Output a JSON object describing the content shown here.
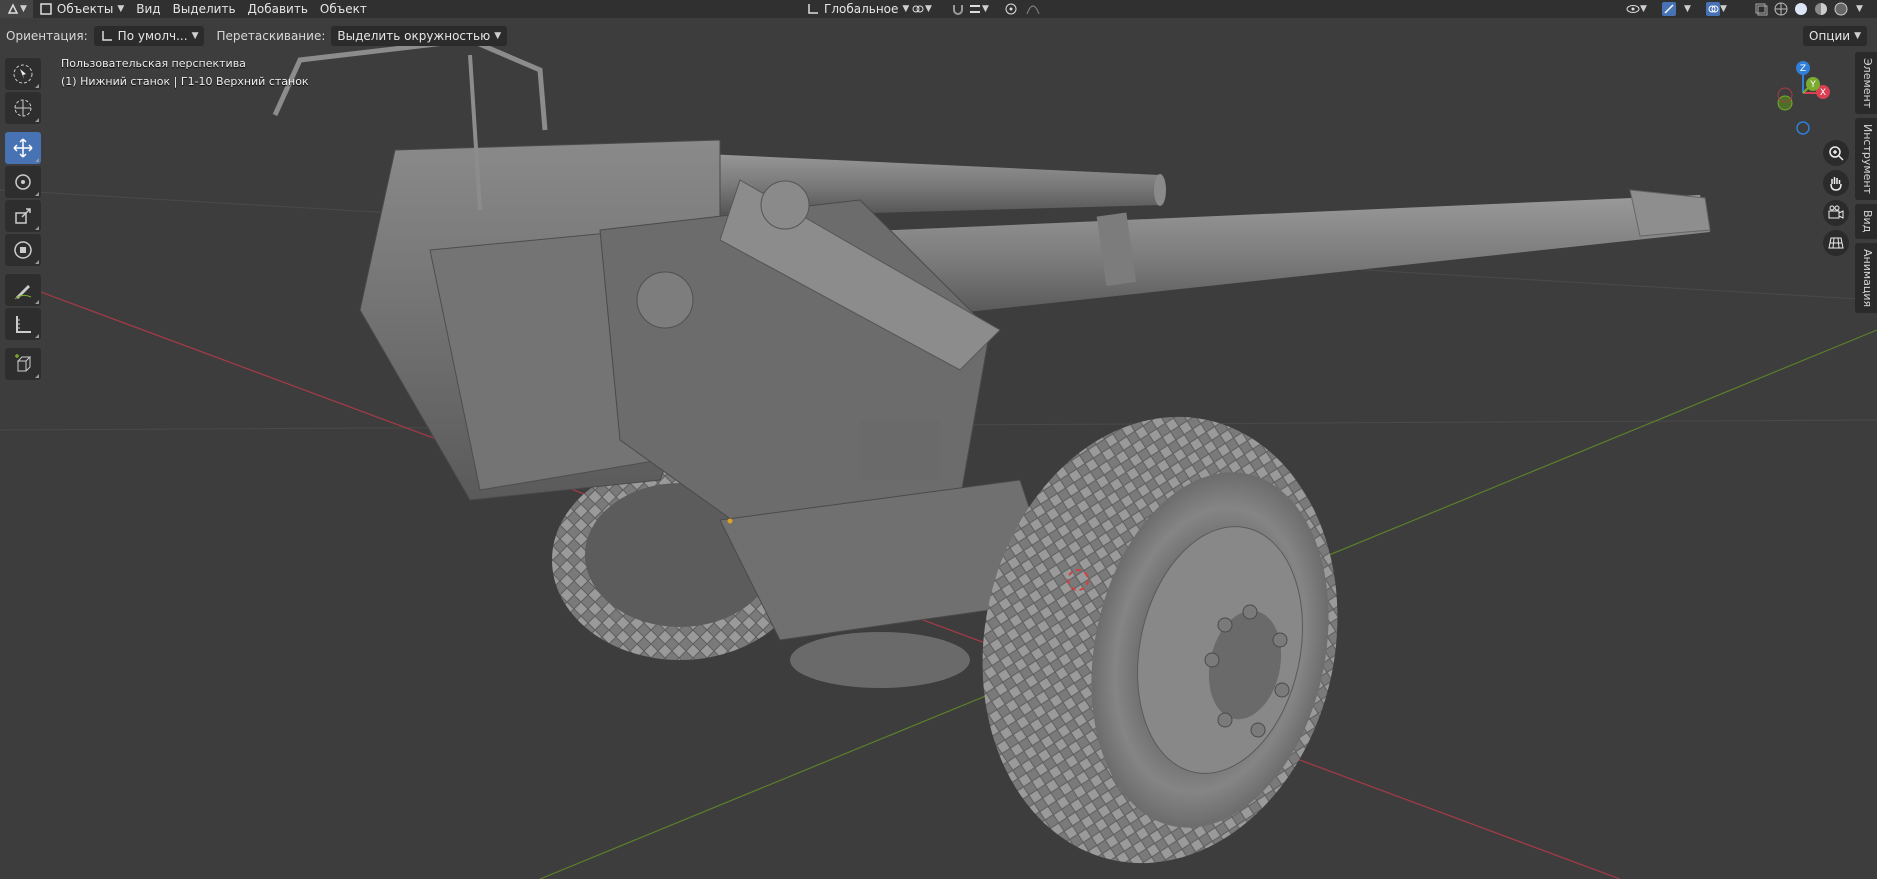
{
  "header": {
    "mode_label": "Объекты",
    "menus": [
      "Вид",
      "Выделить",
      "Добавить",
      "Объект"
    ],
    "transform_orientation": "Глобальное"
  },
  "tool_header": {
    "orientation_label": "Ориентация:",
    "orientation_value": "По умолч...",
    "drag_label": "Перетаскивание:",
    "drag_value": "Выделить окружностью",
    "options_label": "Опции"
  },
  "viewport": {
    "view_name": "Пользовательская перспектива",
    "object_info": "(1) Нижний станок | Г1-10 Верхний станок"
  },
  "gizmo": {
    "z": "Z",
    "y": "Y",
    "x": "X"
  },
  "side_tabs": [
    "Элемент",
    "Инструмент",
    "Вид",
    "Анимация"
  ],
  "tools": [
    "select-tool",
    "cursor-tool",
    "move-tool",
    "rotate-tool",
    "scale-tool",
    "transform-tool",
    "annotate-tool",
    "measure-tool",
    "add-cube-tool"
  ],
  "colors": {
    "active_tool": "#4772b3",
    "x_axis": "#d94052",
    "y_axis": "#7bab2e",
    "z_axis": "#2f7fd8"
  }
}
